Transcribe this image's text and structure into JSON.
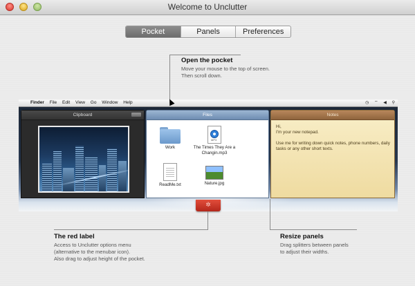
{
  "window": {
    "title": "Welcome to Unclutter"
  },
  "tabs": [
    {
      "label": "Pocket",
      "active": true
    },
    {
      "label": "Panels",
      "active": false
    },
    {
      "label": "Preferences",
      "active": false
    }
  ],
  "callouts": {
    "pocket": {
      "title": "Open the pocket",
      "lines": [
        "Move your mouse to the top of screen.",
        "Then scroll down."
      ]
    },
    "red_label": {
      "title": "The red label",
      "lines": [
        "Access to Unclutter options menu",
        "(alternative to the menubar icon).",
        "Also drag to adjust height of the pocket."
      ]
    },
    "resize": {
      "title": "Resize panels",
      "lines": [
        "Drag splitters between panels",
        "to adjust their widths."
      ]
    }
  },
  "menubar": {
    "items": [
      "Finder",
      "File",
      "Edit",
      "View",
      "Go",
      "Window",
      "Help"
    ],
    "right_icons": [
      "clock-icon",
      "wifi-icon",
      "volume-icon",
      "search-icon"
    ]
  },
  "panels": {
    "clipboard": {
      "title": "Clipboard"
    },
    "files": {
      "title": "Files",
      "items": [
        {
          "name": "Work",
          "icon": "folder-icon"
        },
        {
          "name": "The Times They Are a Changin.mp3",
          "icon": "audio-file-icon",
          "badge": "MP3"
        },
        {
          "name": "ReadMe.txt",
          "icon": "text-file-icon"
        },
        {
          "name": "Nature.jpg",
          "icon": "image-file-icon"
        }
      ]
    },
    "notes": {
      "title": "Notes",
      "greeting": "Hi,",
      "line2": "I'm your new notepad.",
      "line3": "Use me for writing down quick notes, phone numbers, daily tasks or any other short texts."
    }
  },
  "colors": {
    "accent_red": "#c9352a",
    "files_header": "#7f9bbd",
    "notes_header": "#a57650"
  }
}
